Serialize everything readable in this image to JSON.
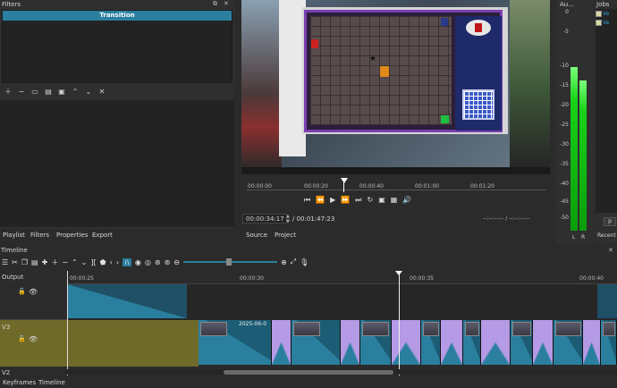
{
  "filters": {
    "title": "Filters",
    "selected_item": "Transition",
    "tools": [
      "plus-icon",
      "minus-icon",
      "copy-icon",
      "paste-icon",
      "save-icon",
      "up-icon",
      "down-icon",
      "close-icon"
    ]
  },
  "left_tabs": [
    "Playlist",
    "Filters",
    "Properties",
    "Export"
  ],
  "player": {
    "ruler": [
      "00:00:00",
      "00:00:20",
      "00:00:40",
      "00:01:00",
      "00:01:20"
    ],
    "timecode": "00:00:34:17",
    "duration": "/ 00:01:47:23",
    "inout": "--:--:--:-- / --:--:--:--",
    "tabs": [
      "Source",
      "Project"
    ],
    "playhead_fraction": 0.33
  },
  "audio": {
    "title": "Au...",
    "scale": [
      "0",
      "-5",
      "-10",
      "-15",
      "-20",
      "-25",
      "-30",
      "-35",
      "-40",
      "-45",
      "-50"
    ],
    "channels": [
      "L",
      "R"
    ]
  },
  "jobs": {
    "title": "Jobs",
    "items": [
      "Ve",
      "Ve"
    ],
    "recent_label": "Recent",
    "p_label": "p"
  },
  "timeline": {
    "title": "Timeline",
    "ruler": [
      "00:00:25",
      "00:00:30",
      "00:00:35",
      "00:00:40"
    ],
    "tracks": [
      "Output",
      "V3",
      "V2"
    ],
    "clip_label": "2025-06-0",
    "bottom_tabs": [
      "Keyframes",
      "Timeline"
    ]
  },
  "colors": {
    "accent": "#2a7f9f",
    "track_highlight": "#6f6a2a",
    "transition": "#b59ae6",
    "meter": "#19d219"
  }
}
